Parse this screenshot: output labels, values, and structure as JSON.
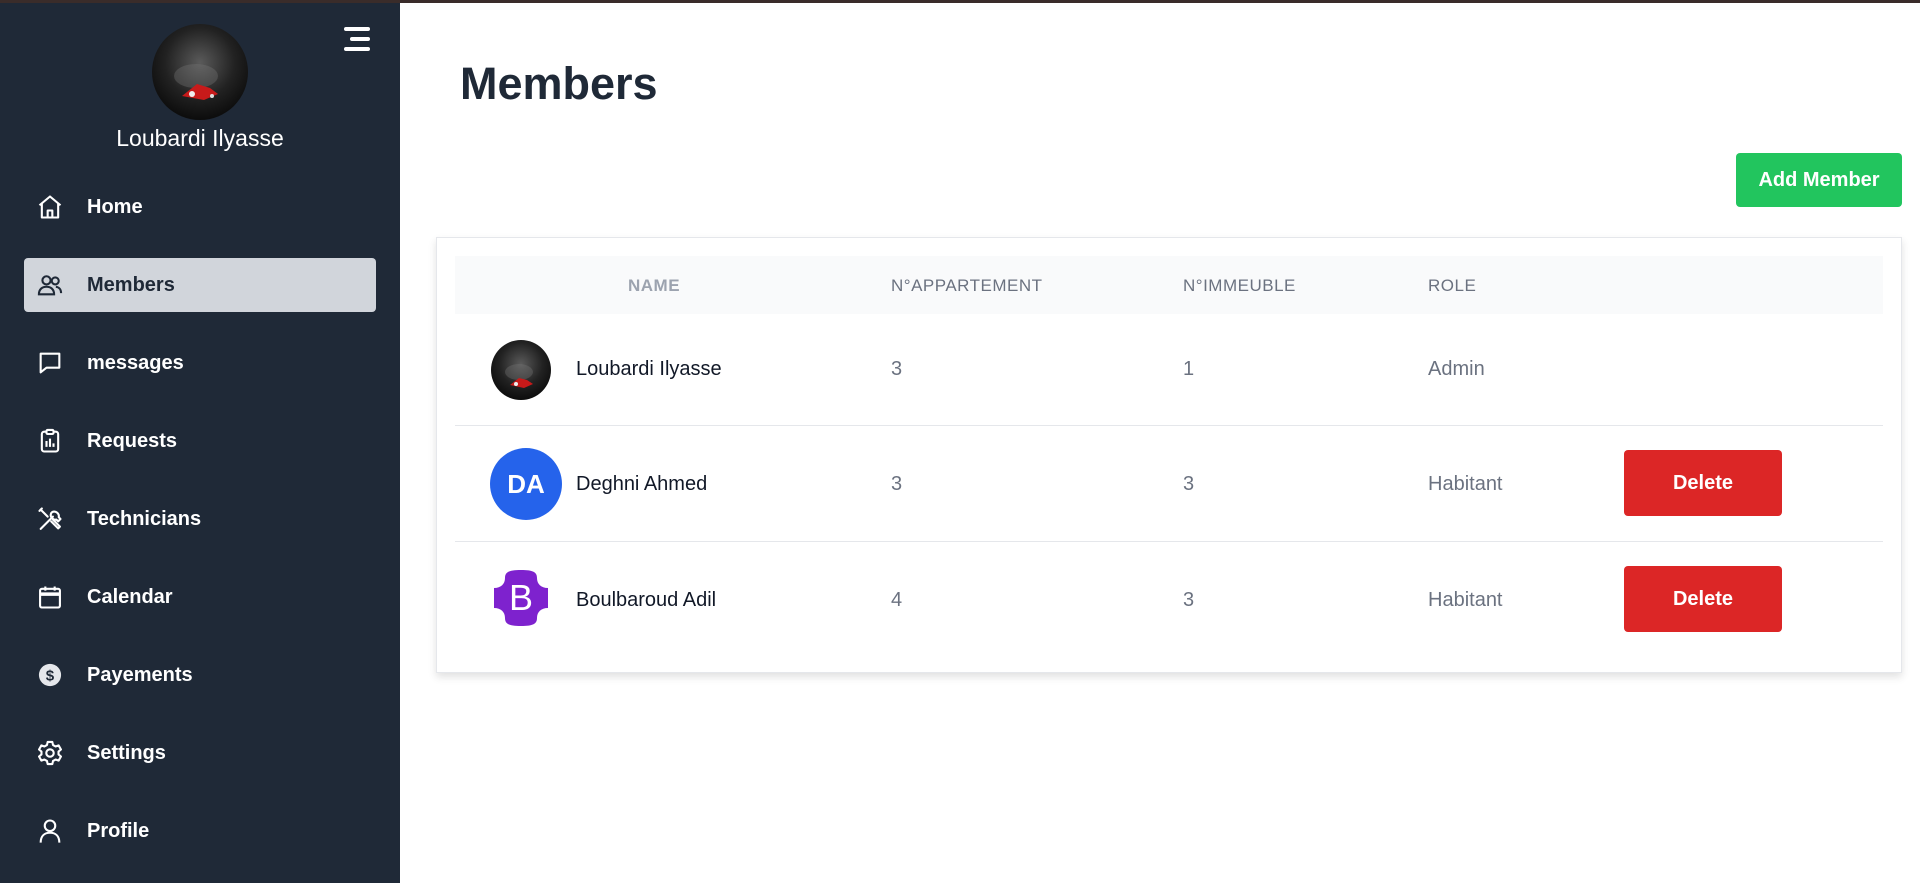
{
  "colors": {
    "sidebar_bg": "#1f2937",
    "active_item_bg": "#d1d5db",
    "add_button": "#22c55e",
    "delete_button": "#dc2626",
    "initials_avatar": "#2563eb",
    "bootstrap_logo": "#7e22ce"
  },
  "sidebar": {
    "user_name": "Loubardi Ilyasse",
    "menu_icon": "hamburger-icon",
    "items": [
      {
        "label": "Home",
        "icon": "home-icon"
      },
      {
        "label": "Members",
        "icon": "users-icon",
        "active": true
      },
      {
        "label": "messages",
        "icon": "chat-icon"
      },
      {
        "label": "Requests",
        "icon": "clipboard-icon"
      },
      {
        "label": "Technicians",
        "icon": "tools-icon"
      },
      {
        "label": "Calendar",
        "icon": "calendar-icon"
      },
      {
        "label": "Payements",
        "icon": "dollar-coin-icon"
      },
      {
        "label": "Settings",
        "icon": "gear-icon"
      },
      {
        "label": "Profile",
        "icon": "user-icon"
      }
    ]
  },
  "main": {
    "title": "Members",
    "add_button_label": "Add Member",
    "table": {
      "headers": [
        "NAME",
        "N°APPARTEMENT",
        "N°IMMEUBLE",
        "ROLE"
      ],
      "rows": [
        {
          "name": "Loubardi Ilyasse",
          "appartement": "3",
          "immeuble": "1",
          "role": "Admin",
          "avatar": "photo"
        },
        {
          "name": "Deghni Ahmed",
          "appartement": "3",
          "immeuble": "3",
          "role": "Habitant",
          "avatar": "initials",
          "initials": "DA",
          "action": "Delete"
        },
        {
          "name": "Boulbaroud Adil",
          "appartement": "4",
          "immeuble": "3",
          "role": "Habitant",
          "avatar": "bootstrap-logo",
          "logo_letter": "B",
          "action": "Delete"
        }
      ]
    }
  }
}
